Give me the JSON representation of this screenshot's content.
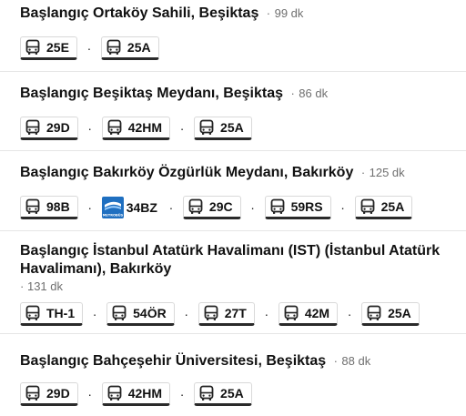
{
  "routes": [
    {
      "title": "Başlangıç Ortaköy Sahili, Beşiktaş",
      "separator": "·",
      "duration": "99 dk",
      "legs": [
        {
          "mode": "bus",
          "icon": "bus-icon",
          "label": "25E"
        },
        {
          "mode": "bus",
          "icon": "bus-icon",
          "label": "25A"
        }
      ]
    },
    {
      "title": "Başlangıç Beşiktaş Meydanı, Beşiktaş",
      "separator": "·",
      "duration": "86 dk",
      "legs": [
        {
          "mode": "bus",
          "icon": "bus-icon",
          "label": "29D"
        },
        {
          "mode": "bus",
          "icon": "bus-icon",
          "label": "42HM"
        },
        {
          "mode": "bus",
          "icon": "bus-icon",
          "label": "25A"
        }
      ]
    },
    {
      "title": "Başlangıç Bakırköy Özgürlük Meydanı, Bakırköy",
      "separator": "·",
      "duration": "125 dk",
      "legs": [
        {
          "mode": "bus",
          "icon": "bus-icon",
          "label": "98B"
        },
        {
          "mode": "metrobus",
          "icon": "metrobus-icon",
          "label": "34BZ",
          "icon_text": "METROBÜS",
          "icon_color": "#1f6fc0"
        },
        {
          "mode": "bus",
          "icon": "bus-icon",
          "label": "29C"
        },
        {
          "mode": "bus",
          "icon": "bus-icon",
          "label": "59RS"
        },
        {
          "mode": "bus",
          "icon": "bus-icon",
          "label": "25A"
        }
      ]
    },
    {
      "title": "Başlangıç İstanbul Atatürk Havalimanı (IST) (İstanbul Atatürk Havalimanı), Bakırköy",
      "separator": "·",
      "duration": "131 dk",
      "legs": [
        {
          "mode": "bus",
          "icon": "bus-icon",
          "label": "TH-1"
        },
        {
          "mode": "bus",
          "icon": "bus-icon",
          "label": "54ÖR"
        },
        {
          "mode": "bus",
          "icon": "bus-icon",
          "label": "27T"
        },
        {
          "mode": "bus",
          "icon": "bus-icon",
          "label": "42M"
        },
        {
          "mode": "bus",
          "icon": "bus-icon",
          "label": "25A"
        }
      ]
    },
    {
      "title": "Başlangıç Bahçeşehir Üniversitesi, Beşiktaş",
      "separator": "·",
      "duration": "88 dk",
      "legs": [
        {
          "mode": "bus",
          "icon": "bus-icon",
          "label": "29D"
        },
        {
          "mode": "bus",
          "icon": "bus-icon",
          "label": "42HM"
        },
        {
          "mode": "bus",
          "icon": "bus-icon",
          "label": "25A"
        }
      ]
    }
  ],
  "leg_separator": "·"
}
